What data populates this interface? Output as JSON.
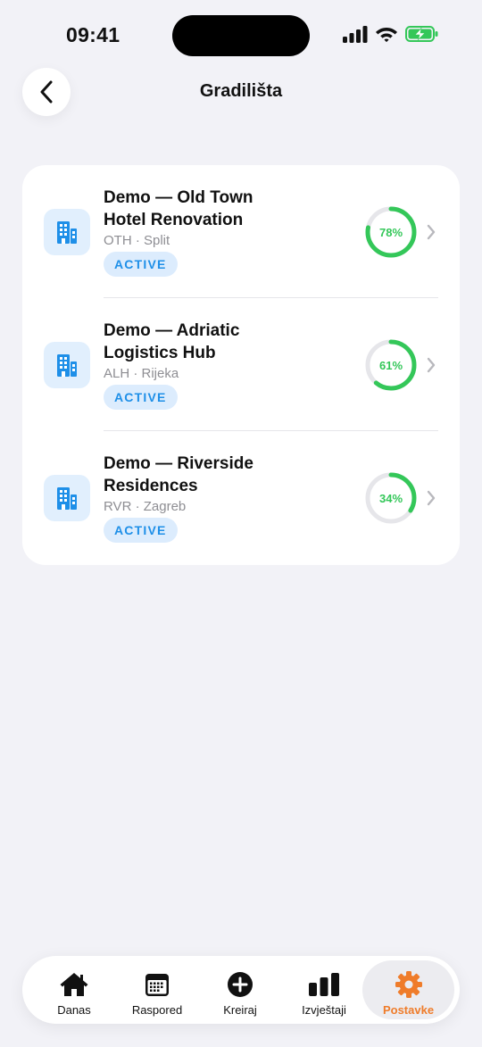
{
  "status_bar": {
    "time": "09:41"
  },
  "header": {
    "title": "Gradilišta"
  },
  "sites": [
    {
      "name": "Demo — Old Town Hotel Renovation",
      "meta": "OTH · Split",
      "status": "ACTIVE",
      "progress_label": "78%",
      "progress": 0.78
    },
    {
      "name": "Demo — Adriatic Logistics Hub",
      "meta": "ALH · Rijeka",
      "status": "ACTIVE",
      "progress_label": "61%",
      "progress": 0.61
    },
    {
      "name": "Demo — Riverside Residences",
      "meta": "RVR · Zagreb",
      "status": "ACTIVE",
      "progress_label": "34%",
      "progress": 0.34
    }
  ],
  "tabs": [
    {
      "label": "Danas",
      "icon": "house-icon"
    },
    {
      "label": "Raspored",
      "icon": "calendar-icon"
    },
    {
      "label": "Kreiraj",
      "icon": "plus-circle-icon"
    },
    {
      "label": "Izvještaji",
      "icon": "bar-chart-icon"
    },
    {
      "label": "Postavke",
      "icon": "gear-icon",
      "active": true
    }
  ],
  "colors": {
    "accent": "#ef7c2a",
    "progress": "#34c759",
    "badge_text": "#1e8fe8",
    "badge_bg": "#dcecfd",
    "icon_tile": "#e1effd",
    "background": "#f2f2f7"
  }
}
